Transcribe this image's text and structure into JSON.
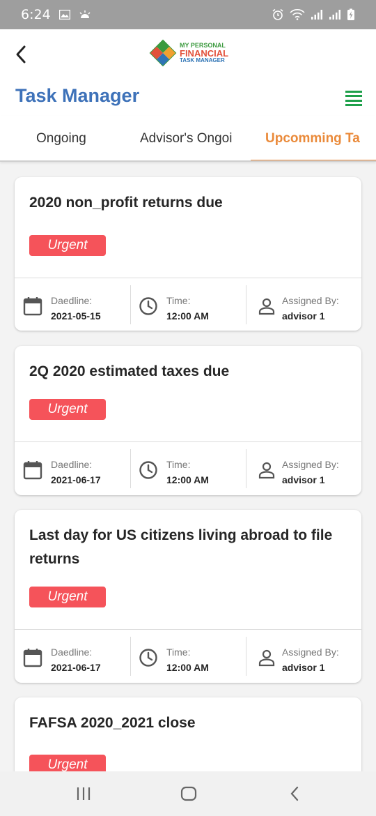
{
  "status_bar": {
    "time": "6:24",
    "left_icons": [
      "image-icon",
      "weather-icon"
    ],
    "right_icons": [
      "alarm-icon",
      "wifi-icon",
      "signal-icon",
      "signal-icon",
      "battery-charging-icon"
    ]
  },
  "header": {
    "logo": {
      "line1": "MY PERSONAL",
      "line2": "FINANCIAL",
      "line3": "TASK MANAGER"
    },
    "title": "Task Manager"
  },
  "tabs": [
    {
      "label": "Ongoing",
      "active": false
    },
    {
      "label": "Advisor's Ongoi",
      "active": false
    },
    {
      "label": "Upcomming Ta",
      "active": true
    }
  ],
  "colors": {
    "accent_orange": "#ea8a3a",
    "title_blue": "#3e72b9",
    "urgent_red": "#f5535a",
    "menu_green": "#1ea04a"
  },
  "tasks": [
    {
      "title": "2020 non_profit returns due",
      "priority": "Urgent",
      "deadline_label": "Daedline:",
      "deadline": "2021-05-15",
      "time_label": "Time:",
      "time": "12:00 AM",
      "assigned_label": "Assigned By:",
      "assigned_by": "advisor 1"
    },
    {
      "title": "2Q 2020 estimated taxes due",
      "priority": "Urgent",
      "deadline_label": "Daedline:",
      "deadline": "2021-06-17",
      "time_label": "Time:",
      "time": "12:00 AM",
      "assigned_label": "Assigned By:",
      "assigned_by": "advisor 1"
    },
    {
      "title": "Last day for US citizens living abroad to file returns",
      "priority": "Urgent",
      "deadline_label": "Daedline:",
      "deadline": "2021-06-17",
      "time_label": "Time:",
      "time": "12:00 AM",
      "assigned_label": "Assigned By:",
      "assigned_by": "advisor 1"
    },
    {
      "title": "FAFSA 2020_2021 close",
      "priority": "Urgent"
    }
  ]
}
